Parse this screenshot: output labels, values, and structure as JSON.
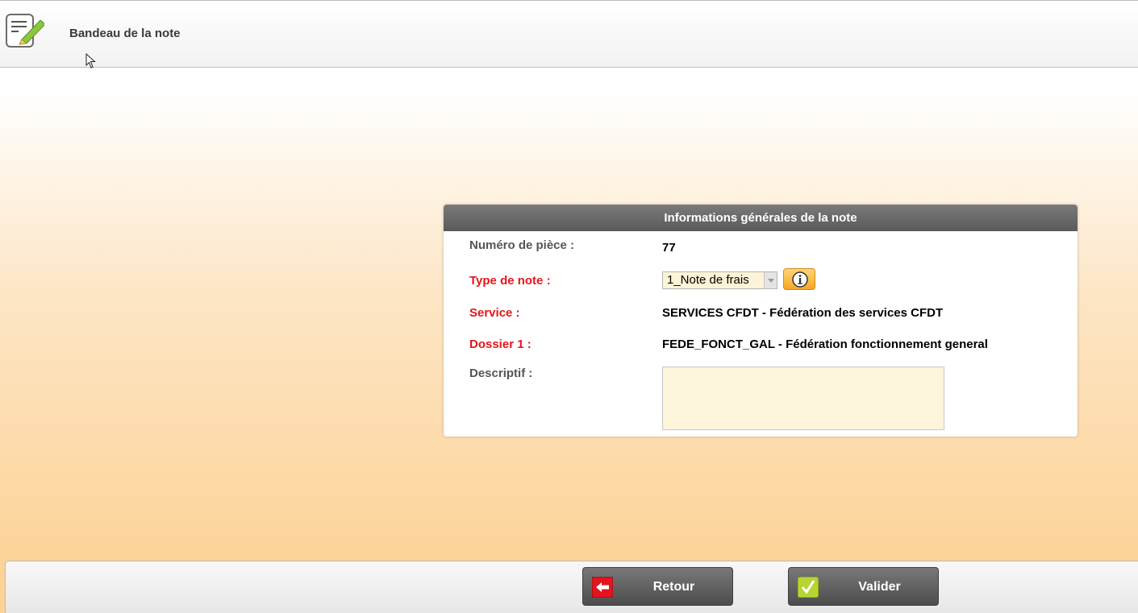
{
  "header": {
    "title": "Bandeau de la note",
    "icon": "edit-note-icon"
  },
  "panel": {
    "title": "Informations générales de la note",
    "fields": {
      "numero": {
        "label": "Numéro de pièce :",
        "value": "77"
      },
      "type_note": {
        "label": "Type de note :",
        "value": "1_Note de frais",
        "info_icon": "info-icon"
      },
      "service": {
        "label": "Service :",
        "value": "SERVICES CFDT - Fédération des services CFDT"
      },
      "dossier": {
        "label": "Dossier 1 :",
        "value": "FEDE_FONCT_GAL - Fédération fonctionnement general"
      },
      "descriptif": {
        "label": "Descriptif :",
        "value": ""
      }
    }
  },
  "footer": {
    "retour_label": "Retour",
    "valider_label": "Valider"
  },
  "colors": {
    "required_label": "#e3161c",
    "normal_label": "#555555",
    "panel_header": "#5a5a5a",
    "background_bottom": "#fdd398"
  }
}
